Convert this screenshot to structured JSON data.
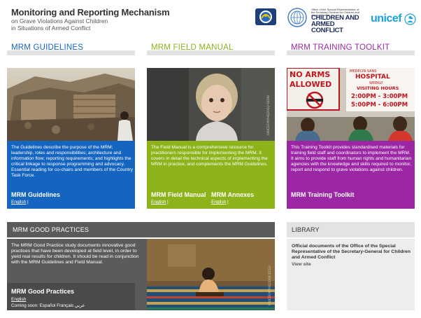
{
  "header": {
    "title": "Monitoring and Reporting Mechanism",
    "subtitle_line1": "on Grave Violations Against Children",
    "subtitle_line2": "in Situations of Armed Conflict",
    "cac_small": "Office of the Special Representative of the Secretary-General for Children and Armed Conflict",
    "cac_line1": "CHILDREN AND",
    "cac_line2": "ARMED CONFLICT",
    "unicef": "unicef"
  },
  "columns": [
    {
      "heading": "MRM GUIDELINES",
      "color": "#1565c0",
      "description": "The Guidelines describe the purpose of the MRM; leadership, roles and responsibilities; architecture and information flow; reporting requirements; and highlights the critical linkage to response programming and advocacy. Essential reading for co-chairs and members of the Country Task Force.",
      "title": "MRM Guidelines",
      "link": "English",
      "sep": "|"
    },
    {
      "heading": "MRM FIELD MANUAL",
      "color": "#8cb31a",
      "description": "The Field Manual is a comprehensive resource for practitioners responsible for implementing the MRM. It covers in detail the technical aspects of implementing the MRM in practice, and complements the MRM Guidelines.",
      "title": "MRM Field Manual",
      "link": "English",
      "sep": "|",
      "title2": "MRM Annexes",
      "link2": "English",
      "sep2": "|"
    },
    {
      "heading": "MRM TRAINING TOOLKIT",
      "color": "#9b27a5",
      "description": "This Training Toolkit provides standardised materials for training field staff and coordinators to implement the MRM. It aims to provide staff from human rights and humanitarian agencies with the knowledge and skills required to monitor, report and respond to grave violations against children.",
      "title": "MRM Training Toolkit"
    }
  ],
  "photos": {
    "watermark": "UNICEF/NYHQ2002-0456/",
    "sign_line1": "NO ARMS",
    "sign_line2": "ALLOWED",
    "hospital_line1": "MEDECIN SANS",
    "hospital_line2": "HOSPITAL",
    "hospital_line3": "WEEKLY",
    "hospital_line4": "VISITING HOURS",
    "hospital_line5": "2:00PM - 3:00PM",
    "hospital_line6": "5:00PM - 6:00PM"
  },
  "good_practices": {
    "heading": "MRM GOOD PRACTICES",
    "description": "The MRM Good Practice study documents innovative good practices that have been developed at field level, in order to yield real results for children. It should be read in conjunction with the MRM Guidelines and Field Manual.",
    "title": "MRM Good Practices",
    "link": "English",
    "coming_soon": "Coming soon: Español Français عربي",
    "watermark": "UNICEF/NYHQ2006-1532/"
  },
  "library": {
    "heading": "LIBRARY",
    "description": "Official documents of the Office of the Special Representative of the Secretary-General for Children and Armed Conflict",
    "link": "View site"
  }
}
